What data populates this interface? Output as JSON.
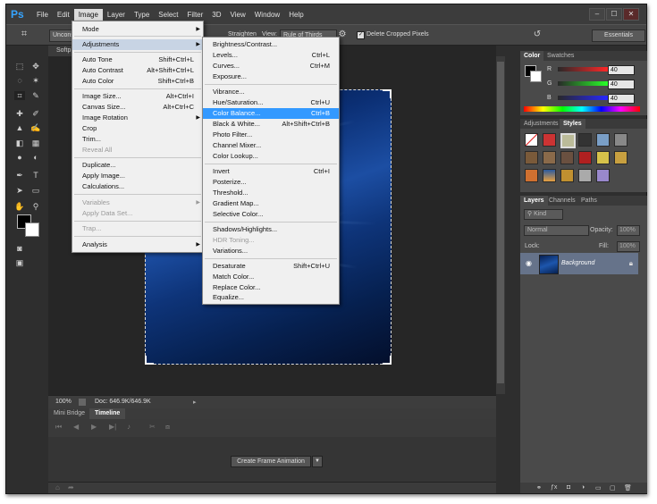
{
  "app": {
    "logo": "Ps"
  },
  "menubar": {
    "items": [
      "File",
      "Edit",
      "Image",
      "Layer",
      "Type",
      "Select",
      "Filter",
      "3D",
      "View",
      "Window",
      "Help"
    ],
    "active": "Image",
    "window_controls": [
      "–",
      "☐",
      "✕"
    ]
  },
  "options": {
    "preset_value": "Uncons",
    "tool_label": "Straighten",
    "view_label": "View:",
    "view_value": "Rule of Thirds",
    "delete_cropped_label": "Delete Cropped Pixels",
    "workspace": "Essentials"
  },
  "document": {
    "tab_label": "Softp",
    "zoom": "100%",
    "doc_info": "Doc: 646.9K/646.9K"
  },
  "timeline": {
    "tabs": [
      "Mini Bridge",
      "Timeline"
    ],
    "active_tab": "Timeline",
    "create_button": "Create Frame Animation"
  },
  "color_panel": {
    "tabs": [
      "Color",
      "Swatches"
    ],
    "channels": [
      {
        "label": "R",
        "value": "40",
        "color": "#d03030"
      },
      {
        "label": "G",
        "value": "40",
        "color": "#30b030"
      },
      {
        "label": "B",
        "value": "40",
        "color": "#3050d0"
      }
    ]
  },
  "adjustments_panel": {
    "tabs": [
      "Adjustments",
      "Styles"
    ]
  },
  "layers_panel": {
    "tabs": [
      "Layers",
      "Channels",
      "Paths"
    ],
    "filter_label": "Kind",
    "blend_mode": "Normal",
    "opacity_label": "Opacity:",
    "opacity_value": "100%",
    "lock_label": "Lock:",
    "fill_label": "Fill:",
    "fill_value": "100%",
    "layer_name": "Background"
  },
  "image_menu": {
    "items": [
      {
        "label": "Mode",
        "shortcut": "",
        "submenu": true,
        "disabled": false
      },
      {
        "label": "Adjustments",
        "shortcut": "",
        "submenu": true,
        "disabled": false
      },
      {
        "label": "Auto Tone",
        "shortcut": "Shift+Ctrl+L",
        "submenu": false,
        "disabled": false
      },
      {
        "label": "Auto Contrast",
        "shortcut": "Alt+Shift+Ctrl+L",
        "submenu": false,
        "disabled": false
      },
      {
        "label": "Auto Color",
        "shortcut": "Shift+Ctrl+B",
        "submenu": false,
        "disabled": false
      },
      {
        "label": "Image Size...",
        "shortcut": "Alt+Ctrl+I",
        "submenu": false,
        "disabled": false
      },
      {
        "label": "Canvas Size...",
        "shortcut": "Alt+Ctrl+C",
        "submenu": false,
        "disabled": false
      },
      {
        "label": "Image Rotation",
        "shortcut": "",
        "submenu": true,
        "disabled": false
      },
      {
        "label": "Crop",
        "shortcut": "",
        "submenu": false,
        "disabled": false
      },
      {
        "label": "Trim...",
        "shortcut": "",
        "submenu": false,
        "disabled": false
      },
      {
        "label": "Reveal All",
        "shortcut": "",
        "submenu": false,
        "disabled": true
      },
      {
        "label": "Duplicate...",
        "shortcut": "",
        "submenu": false,
        "disabled": false
      },
      {
        "label": "Apply Image...",
        "shortcut": "",
        "submenu": false,
        "disabled": false
      },
      {
        "label": "Calculations...",
        "shortcut": "",
        "submenu": false,
        "disabled": false
      },
      {
        "label": "Variables",
        "shortcut": "",
        "submenu": true,
        "disabled": true
      },
      {
        "label": "Apply Data Set...",
        "shortcut": "",
        "submenu": false,
        "disabled": true
      },
      {
        "label": "Trap...",
        "shortcut": "",
        "submenu": false,
        "disabled": true
      },
      {
        "label": "Analysis",
        "shortcut": "",
        "submenu": true,
        "disabled": false
      }
    ]
  },
  "adjustments_menu": {
    "items": [
      {
        "label": "Brightness/Contrast...",
        "shortcut": "",
        "disabled": false
      },
      {
        "label": "Levels...",
        "shortcut": "Ctrl+L",
        "disabled": false
      },
      {
        "label": "Curves...",
        "shortcut": "Ctrl+M",
        "disabled": false
      },
      {
        "label": "Exposure...",
        "shortcut": "",
        "disabled": false
      },
      {
        "label": "Vibrance...",
        "shortcut": "",
        "disabled": false
      },
      {
        "label": "Hue/Saturation...",
        "shortcut": "Ctrl+U",
        "disabled": false
      },
      {
        "label": "Color Balance...",
        "shortcut": "Ctrl+B",
        "disabled": false
      },
      {
        "label": "Black & White...",
        "shortcut": "Alt+Shift+Ctrl+B",
        "disabled": false
      },
      {
        "label": "Photo Filter...",
        "shortcut": "",
        "disabled": false
      },
      {
        "label": "Channel Mixer...",
        "shortcut": "",
        "disabled": false
      },
      {
        "label": "Color Lookup...",
        "shortcut": "",
        "disabled": false
      },
      {
        "label": "Invert",
        "shortcut": "Ctrl+I",
        "disabled": false
      },
      {
        "label": "Posterize...",
        "shortcut": "",
        "disabled": false
      },
      {
        "label": "Threshold...",
        "shortcut": "",
        "disabled": false
      },
      {
        "label": "Gradient Map...",
        "shortcut": "",
        "disabled": false
      },
      {
        "label": "Selective Color...",
        "shortcut": "",
        "disabled": false
      },
      {
        "label": "Shadows/Highlights...",
        "shortcut": "",
        "disabled": false
      },
      {
        "label": "HDR Toning...",
        "shortcut": "",
        "disabled": true
      },
      {
        "label": "Variations...",
        "shortcut": "",
        "disabled": false
      },
      {
        "label": "Desaturate",
        "shortcut": "Shift+Ctrl+U",
        "disabled": false
      },
      {
        "label": "Match Color...",
        "shortcut": "",
        "disabled": false
      },
      {
        "label": "Replace Color...",
        "shortcut": "",
        "disabled": false
      },
      {
        "label": "Equalize...",
        "shortcut": "",
        "disabled": false
      }
    ],
    "highlighted": "Color Balance..."
  }
}
